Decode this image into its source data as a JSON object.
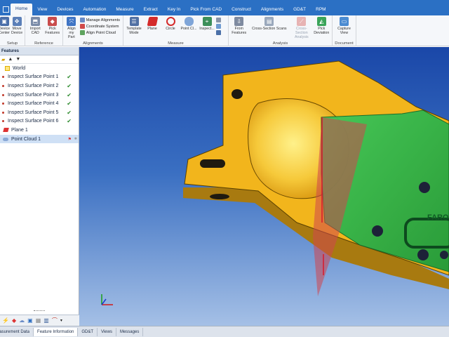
{
  "menu": {
    "tabs": [
      "Home",
      "View",
      "Devices",
      "Automation",
      "Measure",
      "Extract",
      "Key In",
      "Pick From CAD",
      "Construct",
      "Alignments",
      "GD&T",
      "RPM"
    ],
    "active_index": 0
  },
  "ribbon": {
    "setup": {
      "label": "Setup",
      "device_center": "Device Center",
      "move_device": "Move Device"
    },
    "reference": {
      "label": "Reference",
      "import_cad": "Import CAD",
      "pick_features": "Pick Features"
    },
    "alignments": {
      "label": "Alignments",
      "align_my_part": "Align my Part",
      "manage": "Manage Alignments",
      "coordinate_system": "Coordinate System",
      "align_point_cloud": "Align Point Cloud"
    },
    "measure": {
      "label": "Measure",
      "template_mode": "Template Mode",
      "plane": "Plane",
      "circle": "Circle",
      "point_cloud": "Point Cl...",
      "inspect": "Inspect..."
    },
    "analysis": {
      "label": "Analysis",
      "from_features": "From Features",
      "cross_section_scans": "Cross-Section Scans",
      "cross_section_analysis": "Cross-Section Analysis",
      "pick_deviation": "Pick Deviation"
    },
    "document": {
      "label": "Document",
      "capture_view": "Capture View"
    }
  },
  "features_panel": {
    "title": "Features",
    "items": [
      {
        "label": "World",
        "type": "world"
      },
      {
        "label": "Inspect Surface Point 1",
        "type": "point",
        "checked": true
      },
      {
        "label": "Inspect Surface Point 2",
        "type": "point",
        "checked": true
      },
      {
        "label": "Inspect Surface Point 3",
        "type": "point",
        "checked": true
      },
      {
        "label": "Inspect Surface Point 4",
        "type": "point",
        "checked": true
      },
      {
        "label": "Inspect Surface Point 5",
        "type": "point",
        "checked": true
      },
      {
        "label": "Inspect Surface Point 6",
        "type": "point",
        "checked": true
      },
      {
        "label": "Plane 1",
        "type": "plane"
      },
      {
        "label": "Point Cloud 1",
        "type": "cloud",
        "selected": true
      }
    ]
  },
  "viewport": {
    "part_text": "FARO",
    "colors": {
      "part": "#f2b51c",
      "scan": "#2fb84a",
      "plane": "#d0464e",
      "background_top": "#1a47a8",
      "background_bottom": "#a5c0e6"
    }
  },
  "bottom_tabs": [
    "Measurement Data",
    "Feature Information",
    "GD&T",
    "Views",
    "Messages"
  ],
  "bottom_active_index": 1
}
